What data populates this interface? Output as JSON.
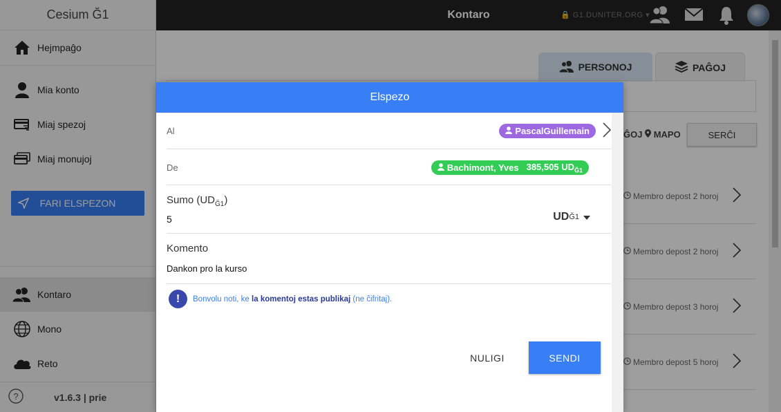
{
  "sidebar": {
    "app_title": "Cesium Ğ1",
    "items": [
      {
        "label": "Hejmpaĝo"
      },
      {
        "label": "Mia konto"
      },
      {
        "label": "Miaj spezoj"
      },
      {
        "label": "Miaj monujoj"
      }
    ],
    "send_button": "FARI ELSPEZON",
    "bottom_items": [
      {
        "label": "Kontaro"
      },
      {
        "label": "Mono"
      },
      {
        "label": "Reto"
      }
    ],
    "version": "v1.6.3 | prie"
  },
  "topbar": {
    "title": "Kontaro",
    "node": "G1.DUNITER.ORG"
  },
  "main": {
    "tabs": [
      {
        "label": "PERSONOJ"
      },
      {
        "label": "PAĜOJ"
      }
    ],
    "filter_text": "ĜOJ",
    "map_label": "MAPO",
    "search_button": "SERĈI",
    "rows": [
      {
        "meta": "Membro depost 2 horoj"
      },
      {
        "meta": "Membro depost 2 horoj"
      },
      {
        "meta": "Membro depost 3 horoj"
      },
      {
        "meta": "Membro depost 5 horoj"
      }
    ]
  },
  "modal": {
    "title": "Elspezo",
    "to_label": "Al",
    "to_value": "PascalGuillemain",
    "from_label": "De",
    "from_name": "Bachimont, Yves",
    "from_balance": "385,505 UD",
    "from_balance_sub": "Ğ1",
    "amount_label": "Sumo (UD",
    "amount_label_sub": "Ğ1",
    "amount_label_end": ")",
    "amount_value": "5",
    "unit": "UD",
    "unit_sub": "Ğ1",
    "comment_label": "Komento",
    "comment_value": "Dankon pro la kurso",
    "notice_prefix": "Bonvolu noti, ke ",
    "notice_bold": "la komentoj estas publikaj",
    "notice_suffix": " (ne ĉifritaj).",
    "cancel_button": "NULIGI",
    "submit_button": "SENDI"
  },
  "colors": {
    "primary": "#387ef5",
    "to_badge": "#9d68e0",
    "from_badge": "#33cc55",
    "topbar": "#222222"
  }
}
